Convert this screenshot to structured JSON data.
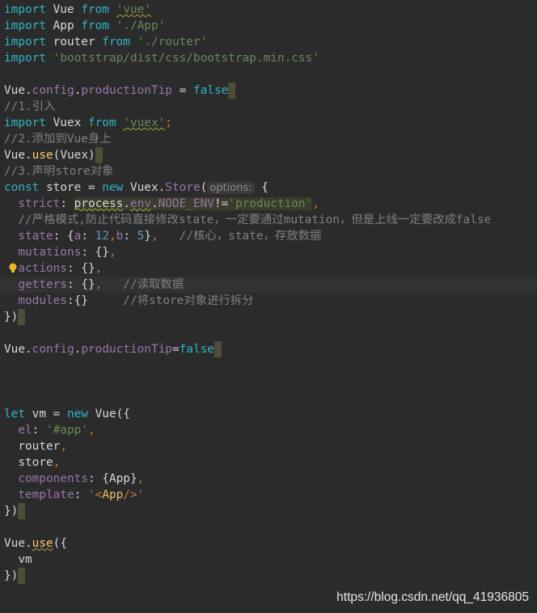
{
  "editor": {
    "current_line": 17,
    "lines": [
      [
        [
          "import",
          "keyword"
        ],
        [
          " Vue ",
          "plain"
        ],
        [
          "from",
          "keyword"
        ],
        [
          " ",
          "plain"
        ],
        [
          "'vue'",
          "string",
          "squiggle"
        ]
      ],
      [
        [
          "import",
          "keyword"
        ],
        [
          " App ",
          "plain"
        ],
        [
          "from",
          "keyword"
        ],
        [
          " ",
          "plain"
        ],
        [
          "'./App'",
          "string"
        ]
      ],
      [
        [
          "import",
          "keyword"
        ],
        [
          " router ",
          "plain"
        ],
        [
          "from",
          "keyword"
        ],
        [
          " ",
          "plain"
        ],
        [
          "'./router'",
          "string"
        ]
      ],
      [
        [
          "import",
          "keyword"
        ],
        [
          " ",
          "plain"
        ],
        [
          "'bootstrap/dist/css/bootstrap.min.css'",
          "string"
        ]
      ],
      [],
      [
        [
          "Vue",
          "plain"
        ],
        [
          ".",
          "plain"
        ],
        [
          "config",
          "prop"
        ],
        [
          ".",
          "plain"
        ],
        [
          "productionTip",
          "prop"
        ],
        [
          " = ",
          "plain"
        ],
        [
          "false",
          "keyword"
        ],
        [
          "",
          "caret"
        ]
      ],
      [
        [
          "//1.引入",
          "comment"
        ]
      ],
      [
        [
          "import",
          "keyword"
        ],
        [
          " Vuex ",
          "plain"
        ],
        [
          "from",
          "keyword"
        ],
        [
          " ",
          "plain"
        ],
        [
          "'vuex'",
          "string",
          "squiggle"
        ],
        [
          ";",
          "punct"
        ]
      ],
      [
        [
          "//2.添加到Vue身上",
          "comment"
        ]
      ],
      [
        [
          "Vue",
          "plain"
        ],
        [
          ".",
          "plain"
        ],
        [
          "use",
          "func"
        ],
        [
          "(Vuex)",
          "plain"
        ],
        [
          "",
          "caret"
        ]
      ],
      [
        [
          "//3.声明store对象",
          "comment"
        ]
      ],
      [
        [
          "const",
          "keyword"
        ],
        [
          " store = ",
          "plain"
        ],
        [
          "new",
          "keyword"
        ],
        [
          " Vuex.",
          "plain"
        ],
        [
          "Store",
          "prop"
        ],
        [
          "(",
          "plain"
        ],
        [
          "options:",
          "hint"
        ],
        [
          " {",
          "plain"
        ]
      ],
      [
        [
          "  ",
          "plain"
        ],
        [
          "strict",
          "prop"
        ],
        [
          ": ",
          "plain"
        ],
        [
          "process",
          "plain",
          "hl squiggle"
        ],
        [
          ".",
          "plain",
          "hl"
        ],
        [
          "env",
          "prop",
          "hl squiggle"
        ],
        [
          ".",
          "plain",
          "hl"
        ],
        [
          "NODE_ENV",
          "prop",
          "hl"
        ],
        [
          "!=",
          "plain",
          "hl"
        ],
        [
          "'production'",
          "string",
          "hl"
        ],
        [
          ",",
          "punct"
        ]
      ],
      [
        [
          "  //严格模式,防止代码直接修改state，一定要通过mutation，但是上线一定要改成false",
          "comment"
        ]
      ],
      [
        [
          "  ",
          "plain"
        ],
        [
          "state",
          "prop"
        ],
        [
          ": {",
          "plain"
        ],
        [
          "a",
          "prop"
        ],
        [
          ": ",
          "plain"
        ],
        [
          "12",
          "number"
        ],
        [
          ",",
          "punct"
        ],
        [
          "b",
          "prop"
        ],
        [
          ": ",
          "plain"
        ],
        [
          "5",
          "number"
        ],
        [
          "}",
          "plain"
        ],
        [
          ",",
          "punct"
        ],
        [
          "   //核心，state，存放数据",
          "comment"
        ]
      ],
      [
        [
          "  ",
          "plain"
        ],
        [
          "mutations",
          "prop"
        ],
        [
          ": {}",
          "plain"
        ],
        [
          ",",
          "punct"
        ]
      ],
      [
        [
          "  ",
          "plain"
        ],
        [
          "actions",
          "prop"
        ],
        [
          ": {}",
          "plain"
        ],
        [
          ",",
          "punct"
        ]
      ],
      [
        [
          "  ",
          "plain"
        ],
        [
          "getters",
          "prop"
        ],
        [
          ": {}",
          "plain"
        ],
        [
          ",",
          "punct"
        ],
        [
          "   //读取数据",
          "comment"
        ]
      ],
      [
        [
          "  ",
          "plain"
        ],
        [
          "modules",
          "prop"
        ],
        [
          ":{}",
          "plain"
        ],
        [
          "     //将store对象进行拆分",
          "comment"
        ]
      ],
      [
        [
          "})",
          "plain"
        ],
        [
          "",
          "caret"
        ]
      ],
      [],
      [
        [
          "Vue",
          "plain"
        ],
        [
          ".",
          "plain"
        ],
        [
          "config",
          "prop"
        ],
        [
          ".",
          "plain"
        ],
        [
          "productionTip",
          "prop"
        ],
        [
          "=",
          "plain"
        ],
        [
          "false",
          "keyword"
        ],
        [
          "",
          "caret"
        ]
      ],
      [],
      [],
      [],
      [
        [
          "let",
          "keyword"
        ],
        [
          " vm = ",
          "plain"
        ],
        [
          "new",
          "keyword"
        ],
        [
          " Vue({",
          "plain"
        ]
      ],
      [
        [
          "  ",
          "plain"
        ],
        [
          "el",
          "prop"
        ],
        [
          ": ",
          "plain"
        ],
        [
          "'#app'",
          "string"
        ],
        [
          ",",
          "punct"
        ]
      ],
      [
        [
          "  router",
          "plain"
        ],
        [
          ",",
          "punct"
        ]
      ],
      [
        [
          "  store",
          "plain"
        ],
        [
          ",",
          "punct"
        ]
      ],
      [
        [
          "  ",
          "plain"
        ],
        [
          "components",
          "prop"
        ],
        [
          ": {App}",
          "plain"
        ],
        [
          ",",
          "punct"
        ]
      ],
      [
        [
          "  ",
          "plain"
        ],
        [
          "template",
          "prop"
        ],
        [
          ": ",
          "plain"
        ],
        [
          "'",
          "string"
        ],
        [
          "<",
          "punct"
        ],
        [
          "App",
          "tag"
        ],
        [
          "/>",
          "punct"
        ],
        [
          "'",
          "string"
        ]
      ],
      [
        [
          "})",
          "plain"
        ],
        [
          "",
          "caret"
        ]
      ],
      [],
      [
        [
          "Vue",
          "plain"
        ],
        [
          ".",
          "plain"
        ],
        [
          "use",
          "func",
          "squiggle"
        ],
        [
          "({",
          "plain"
        ]
      ],
      [
        [
          "  vm",
          "plain"
        ]
      ],
      [
        [
          "})",
          "plain"
        ],
        [
          "",
          "caret"
        ]
      ]
    ],
    "intention_bulb_line": 16
  },
  "watermark": "https://blog.csdn.net/qq_41936805"
}
